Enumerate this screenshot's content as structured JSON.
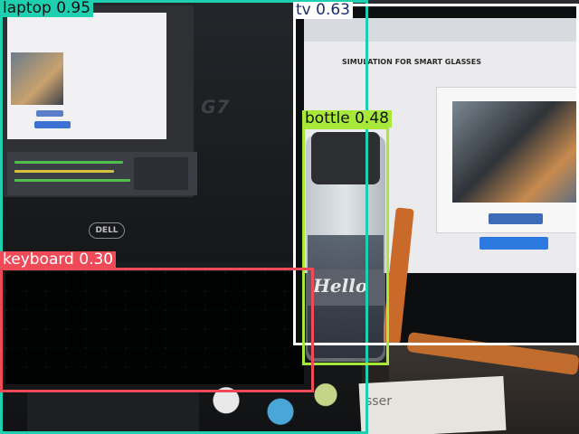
{
  "scene": {
    "dell_logo": "DELL",
    "laptop_model_mark": "G7",
    "monitor_page_title": "SIMULATION FOR SMART GLASSES",
    "bottle_print": "Hello",
    "paper_fragment": "sser"
  },
  "detections": [
    {
      "id": "laptop",
      "label": "laptop 0.95",
      "color": "#1fd0b0",
      "text_color": "#101010"
    },
    {
      "id": "tv",
      "label": "tv 0.63",
      "color": "#ffffff",
      "text_color": "#1a2a6e"
    },
    {
      "id": "bottle",
      "label": "bottle 0.48",
      "color": "#a7e83a",
      "text_color": "#101010"
    },
    {
      "id": "keyboard",
      "label": "keyboard 0.30",
      "color": "#ef4a57",
      "text_color": "#ffffff"
    }
  ]
}
